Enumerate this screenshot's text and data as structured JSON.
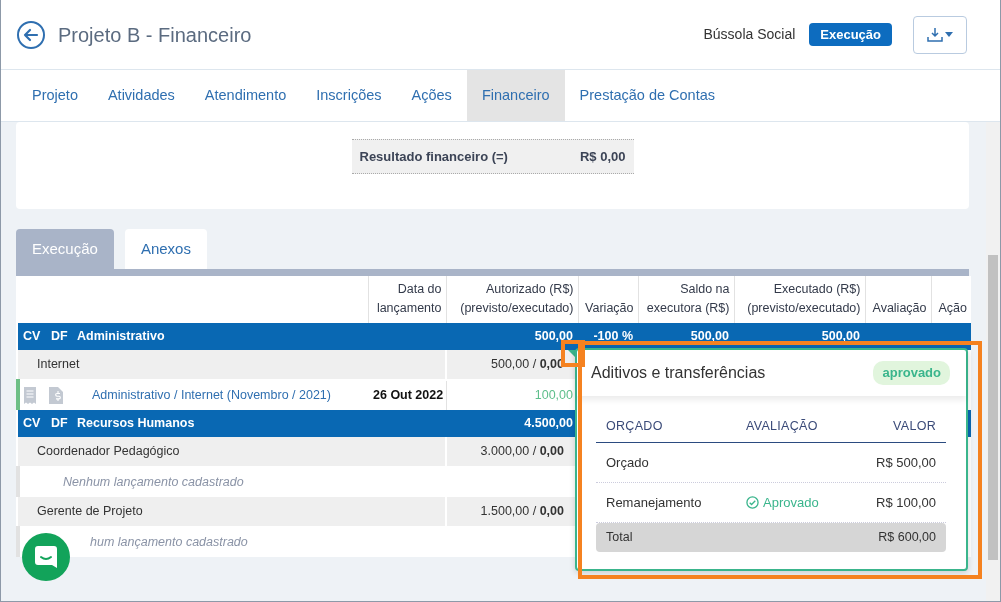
{
  "header": {
    "title": "Projeto B - Financeiro",
    "organization": "Bússola Social",
    "status": "Execução"
  },
  "nav": [
    {
      "label": "Projeto",
      "selected": false
    },
    {
      "label": "Atividades",
      "selected": false
    },
    {
      "label": "Atendimento",
      "selected": false
    },
    {
      "label": "Inscrições",
      "selected": false
    },
    {
      "label": "Ações",
      "selected": false
    },
    {
      "label": "Financeiro",
      "selected": true
    },
    {
      "label": "Prestação de Contas",
      "selected": false
    }
  ],
  "summary": [
    {
      "label": "Resultado financeiro (=)",
      "value": "R$ 0,00"
    }
  ],
  "section_tabs": [
    {
      "label": "Execução",
      "selected": true
    },
    {
      "label": "Anexos",
      "selected": false
    }
  ],
  "table": {
    "columns": [
      "Data do lançamento",
      "Autorizado (R$) (previsto/executado)",
      "Variação",
      "Saldo na executora (R$)",
      "Executado (R$) (previsto/executado)",
      "Avaliação",
      "Ação"
    ],
    "rows": [
      {
        "kind": "group",
        "cv": "CV",
        "df": "DF",
        "name": "Administrativo",
        "authorized": "500,00",
        "variation": "-100 %",
        "balance": "500,00",
        "executed": "500,00"
      },
      {
        "kind": "item",
        "name": "Internet",
        "authorized": "500,00 / **0,00**",
        "flagged": true
      },
      {
        "kind": "entry",
        "link": "Administrativo / Internet (Novembro / 2021)",
        "date": "26 Out 2022",
        "amount": "100,00"
      },
      {
        "kind": "group",
        "cv": "CV",
        "df": "DF",
        "name": "Recursos Humanos",
        "authorized": "4.500,00"
      },
      {
        "kind": "item",
        "name": "Coordenador Pedagógico",
        "authorized": "3.000,00 / **0,00**",
        "flagged": false
      },
      {
        "kind": "empty",
        "text": "Nenhum lançamento cadastrado",
        "partly_covered": false
      },
      {
        "kind": "item",
        "name": "Gerente de Projeto",
        "authorized": "1.500,00 / **0,00**",
        "flagged": false
      },
      {
        "kind": "empty",
        "text": "hum lançamento cadastrado",
        "partly_covered": true
      }
    ]
  },
  "popover": {
    "title": "Aditivos e transferências",
    "status": "aprovado",
    "columns": [
      "ORÇADO",
      "AVALIAÇÃO",
      "VALOR"
    ],
    "rows": [
      {
        "label": "Orçado",
        "value": "R$ 500,00"
      },
      {
        "label": "Remanejamento",
        "evaluation": "Aprovado",
        "value": "R$ 100,00"
      }
    ],
    "total": {
      "label": "Total",
      "value": "R$ 600,00"
    }
  }
}
